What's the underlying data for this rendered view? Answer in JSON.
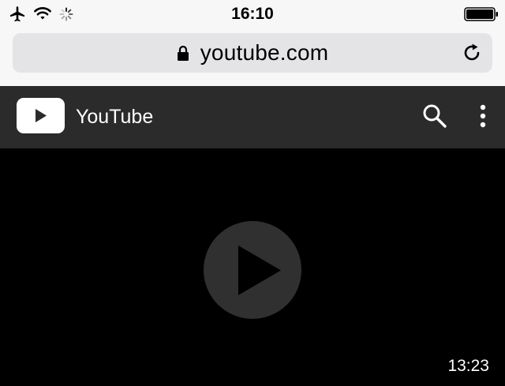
{
  "status_bar": {
    "time": "16:10",
    "icons": [
      "airplane-icon",
      "wifi-icon",
      "activity-spinner-icon",
      "battery-icon"
    ],
    "battery_level": 1.0
  },
  "browser": {
    "url": "youtube.com",
    "secure_icon": "lock-icon",
    "reload_icon": "reload-icon"
  },
  "youtube": {
    "title": "YouTube",
    "logo_icon": "youtube-play-logo-icon",
    "search_icon": "search-icon",
    "menu_icon": "more-vertical-icon"
  },
  "video": {
    "play_icon": "play-icon",
    "duration": "13:23"
  },
  "colors": {
    "status_bg": "#f7f7f7",
    "url_field_bg": "#e4e4e7",
    "header_bg": "#2b2b2b",
    "video_bg": "#000000",
    "play_button_bg": "#303030"
  }
}
